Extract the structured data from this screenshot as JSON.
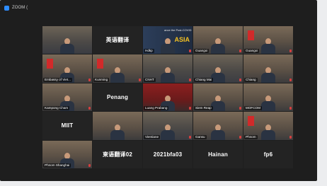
{
  "window": {
    "title": "ZOOM ("
  },
  "tiles": [
    {
      "label": "",
      "center": "",
      "kind": "room"
    },
    {
      "label": "",
      "center": "英语翻译",
      "kind": "text"
    },
    {
      "label": "Hdkp",
      "center": "",
      "kind": "asia",
      "asia": "ASIA",
      "headline": "ance\nthe Post-COVID"
    },
    {
      "label": "Guangxi",
      "center": "",
      "kind": "person"
    },
    {
      "label": "Guangxi",
      "center": "",
      "kind": "person-flag",
      "active": true
    },
    {
      "label": "Embassy of Viet...",
      "center": "",
      "kind": "person-flag"
    },
    {
      "label": "Kunming",
      "center": "",
      "kind": "person-flag"
    },
    {
      "label": "CNHT",
      "center": "",
      "kind": "room"
    },
    {
      "label": "Chiang Mai",
      "center": "",
      "kind": "room"
    },
    {
      "label": "Chiang",
      "center": "",
      "kind": "person"
    },
    {
      "label": "Kampong Cham",
      "center": "",
      "kind": "person"
    },
    {
      "label": "",
      "center": "Penang",
      "kind": "text"
    },
    {
      "label": "Luang Prabang",
      "center": "",
      "kind": "room-red"
    },
    {
      "label": "Siem Reap",
      "center": "",
      "kind": "person"
    },
    {
      "label": "MOFCOM",
      "center": "",
      "kind": "person"
    },
    {
      "label": "",
      "center": "MIIT",
      "kind": "text"
    },
    {
      "label": "",
      "center": "",
      "kind": "person"
    },
    {
      "label": "Vientiane",
      "center": "",
      "kind": "room"
    },
    {
      "label": "Gansu",
      "center": "",
      "kind": "person"
    },
    {
      "label": "Phnom",
      "center": "",
      "kind": "person-flag"
    },
    {
      "label": "Phnom Shanghai",
      "center": "",
      "kind": "person"
    },
    {
      "label": "",
      "center": "柬语翻译02",
      "kind": "text"
    },
    {
      "label": "",
      "center": "2021bfa03",
      "kind": "text"
    },
    {
      "label": "",
      "center": "Hainan",
      "kind": "text"
    },
    {
      "label": "",
      "center": "fp6",
      "kind": "text"
    }
  ]
}
